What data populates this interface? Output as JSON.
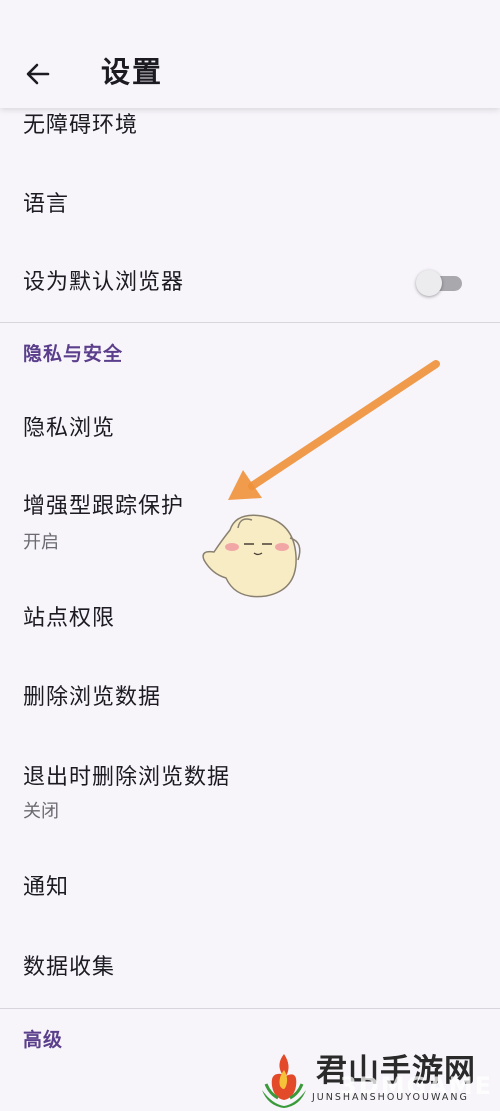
{
  "header": {
    "title": "设置",
    "back_icon": "arrow-left-icon"
  },
  "items": {
    "accessibility": "无障碍环境",
    "language": "语言",
    "default_browser": "设为默认浏览器",
    "private_browsing": "隐私浏览",
    "tracking_protection": "增强型跟踪保护",
    "tracking_protection_status": "开启",
    "site_permissions": "站点权限",
    "delete_browsing_data": "删除浏览数据",
    "delete_on_quit": "退出时删除浏览数据",
    "delete_on_quit_status": "关闭",
    "notifications": "通知",
    "data_collection": "数据收集"
  },
  "sections": {
    "privacy_security": "隐私与安全",
    "advanced": "高级"
  },
  "toggles": {
    "default_browser_enabled": false
  },
  "watermark": {
    "title": "君山手游网",
    "subtitle": "JUNSHANSHOUYOUWANG",
    "overlay": "3DMGAME"
  },
  "colors": {
    "background": "#f7f5fa",
    "section_header": "#5b3f8c",
    "annotation_arrow": "#f0913a"
  }
}
